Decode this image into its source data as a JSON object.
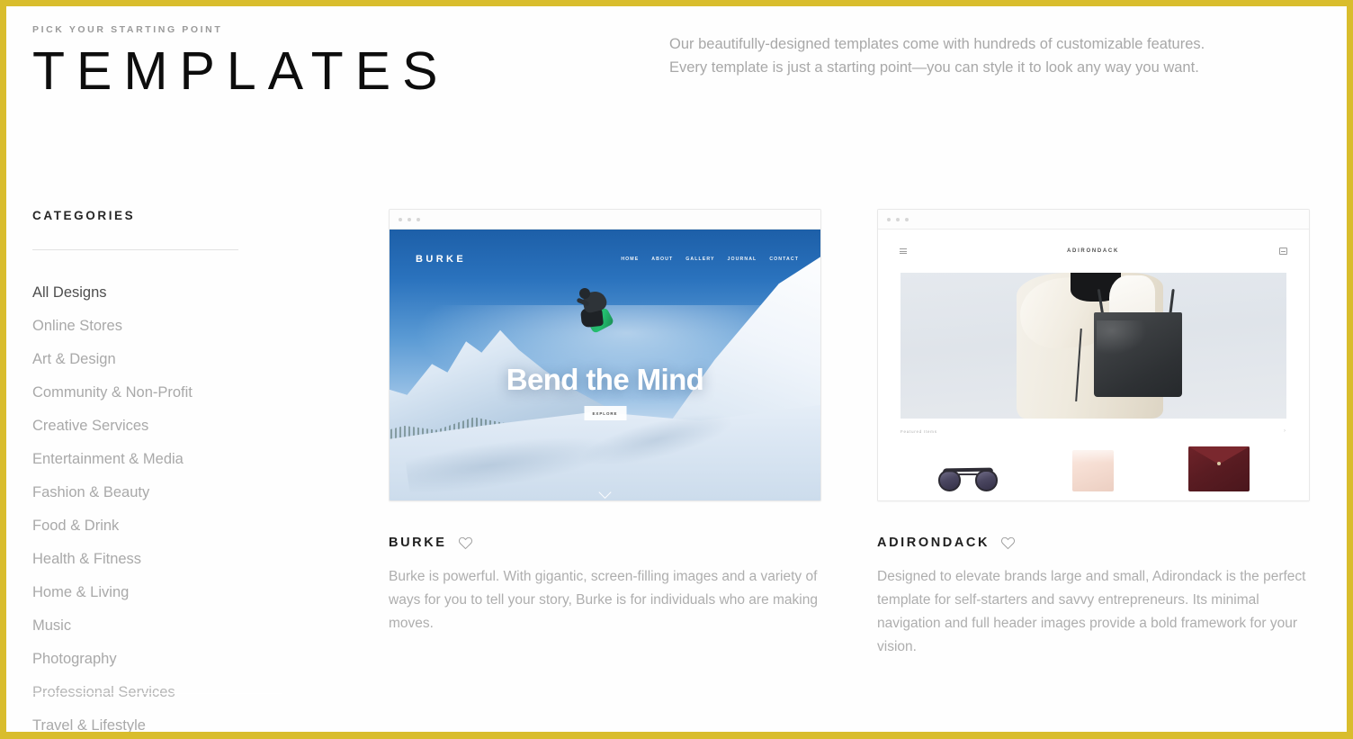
{
  "theme": {
    "frame_color": "#d9bd2d",
    "background": "#fefefe",
    "title_color": "#0d0d0d",
    "muted_text": "#a9a9a9",
    "active_text": "#4e4e4e"
  },
  "header": {
    "eyebrow": "PICK YOUR STARTING POINT",
    "title": "TEMPLATES",
    "description": "Our beautifully-designed templates come with hundreds of customizable features. Every template is just a starting point—you can style it to look any way you want."
  },
  "sidebar": {
    "heading": "CATEGORIES",
    "items": [
      {
        "label": "All Designs",
        "active": true
      },
      {
        "label": "Online Stores",
        "active": false
      },
      {
        "label": "Art & Design",
        "active": false
      },
      {
        "label": "Community & Non-Profit",
        "active": false
      },
      {
        "label": "Creative Services",
        "active": false
      },
      {
        "label": "Entertainment & Media",
        "active": false
      },
      {
        "label": "Fashion & Beauty",
        "active": false
      },
      {
        "label": "Food & Drink",
        "active": false
      },
      {
        "label": "Health & Fitness",
        "active": false
      },
      {
        "label": "Home & Living",
        "active": false
      },
      {
        "label": "Music",
        "active": false
      },
      {
        "label": "Photography",
        "active": false
      },
      {
        "label": "Professional Services",
        "active": false
      },
      {
        "label": "Travel & Lifestyle",
        "active": false
      }
    ]
  },
  "templates": [
    {
      "name": "BURKE",
      "favorite_icon": "heart-outline-icon",
      "description": "Burke is powerful. With gigantic, screen-filling images and a variety of ways for you to tell your story, Burke is for individuals who are making moves.",
      "preview": {
        "logo": "BURKE",
        "nav": [
          "HOME",
          "ABOUT",
          "GALLERY",
          "JOURNAL",
          "CONTACT"
        ],
        "hero_heading": "Bend the Mind",
        "cta_label": "EXPLORE",
        "scroll_icon": "chevron-down-icon"
      }
    },
    {
      "name": "ADIRONDACK",
      "favorite_icon": "heart-outline-icon",
      "description": "Designed to elevate brands large and small, Adirondack is the perfect template for self-starters and savvy entrepreneurs. Its minimal navigation and full header images provide a bold framework for your vision.",
      "preview": {
        "menu_icon": "hamburger-menu-icon",
        "brand": "ADIRONDACK",
        "cart_icon": "shopping-cart-icon",
        "featured_label": "Featured Items",
        "next_arrow": "›",
        "products": [
          "sunglasses",
          "pink-pouch",
          "burgundy-clutch"
        ]
      }
    }
  ]
}
